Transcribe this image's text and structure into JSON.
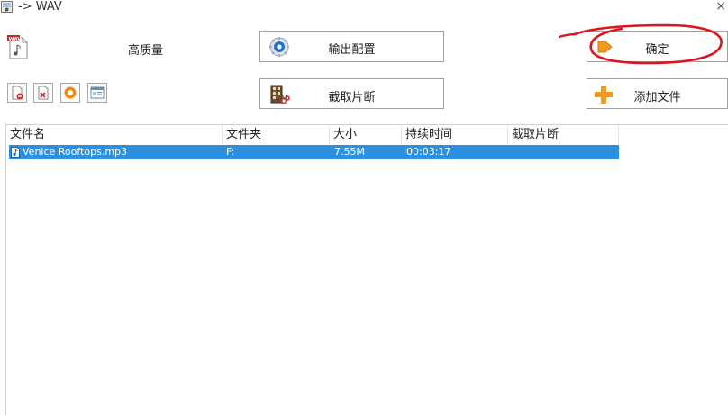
{
  "window": {
    "title": "-> WAV",
    "close_glyph": "×",
    "app_icon": "app-icon"
  },
  "format": {
    "icon": "wav-file-icon",
    "icon_text": "WAV",
    "quality_label": "高质量"
  },
  "buttons": {
    "output_config": {
      "label": "输出配置",
      "icon": "gear-icon"
    },
    "clip_segment": {
      "label": "截取片断",
      "icon": "film-scissors-icon"
    },
    "confirm": {
      "label": "确定",
      "icon": "arrow-right-icon"
    },
    "add_file": {
      "label": "添加文件",
      "icon": "plus-icon"
    }
  },
  "toolbar_small": [
    {
      "name": "remove-file-button",
      "icon": "remove-file-icon"
    },
    {
      "name": "delete-file-button",
      "icon": "delete-file-icon"
    },
    {
      "name": "play-button",
      "icon": "play-icon"
    },
    {
      "name": "file-info-button",
      "icon": "info-window-icon"
    }
  ],
  "file_list": {
    "columns": [
      "文件名",
      "文件夹",
      "大小",
      "持续时间",
      "截取片断"
    ],
    "rows": [
      {
        "name": "Venice Rooftops.mp3",
        "folder": "F:",
        "size": "7.55M",
        "duration": "00:03:17",
        "clip": "",
        "selected": true
      }
    ]
  },
  "colors": {
    "selection": "#2c8fe0",
    "annotation": "#e0141e",
    "accent_orange": "#f29a1f"
  }
}
